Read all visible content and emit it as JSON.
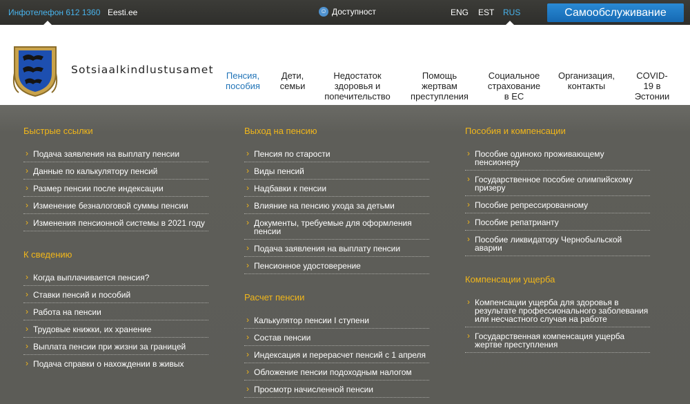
{
  "topbar": {
    "infophone": "Инфотелефон 612 1360",
    "eesti": "Eesti.ee",
    "accessibility": "Доступност",
    "accessibility_icon": "accessibility-icon",
    "lang_eng": "ENG",
    "lang_est": "EST",
    "lang_rus": "RUS",
    "self_service": "Самообслуживание",
    "accent_color": "#48b3ec",
    "button_color": "#1f73b7"
  },
  "header": {
    "site_name": "Sotsiaalkindlustusamet",
    "logo_icon": "crest-icon",
    "nav": [
      {
        "label": "Пенсия, пособия",
        "line1": "Пенсия,",
        "line2": "пособия"
      },
      {
        "label": "Дети, семьи",
        "line1": "Дети,",
        "line2": "семьи"
      },
      {
        "label": "Недостаток здоровья и попечительство",
        "line1": "Недостаток",
        "line2": "здоровья и",
        "line3": "попечительство"
      },
      {
        "label": "Помощь жертвам преступления",
        "line1": "Помощь",
        "line2": "жертвам",
        "line3": "преступления"
      },
      {
        "label": "Социальное страхование в ЕС",
        "line1": "Социальное",
        "line2": "страхование",
        "line3": "в ЕС"
      },
      {
        "label": "Организация, контакты",
        "line1": "Организация,",
        "line2": "контакты"
      },
      {
        "label": "COVID-19 в Эстонии",
        "line1": "COVID-",
        "line2": "19 в",
        "line3": "Эстонии"
      }
    ]
  },
  "menu": {
    "col1": {
      "section1_title": "Быстрые ссылки",
      "section1_items": [
        "Подача заявления на выплату пенсии",
        "Данные по калькулятору пенсий",
        "Размер пенсии после индексации",
        "Изменение безналоговой суммы пенсии",
        "Изменения пенсионной системы в 2021 году"
      ],
      "section2_title": "К сведению",
      "section2_items": [
        "Когда выплачивается пенсия?",
        "Ставки пенсий и пособий",
        "Работа на пенсии",
        "Трудовые книжки, их хранение",
        "Выплата пенсии при жизни за границей",
        "Подача справки о нахождении в живых"
      ]
    },
    "col2": {
      "section1_title": "Выход на пенсию",
      "section1_items": [
        "Пенсия по старости",
        "Виды пенсий",
        "Надбавки к пенсии",
        "Влияние на пенсию ухода за детьми",
        "Документы, требуемые для оформления пенсии",
        "Подача заявления на выплату пенсии",
        "Пенсионное удостоверение"
      ],
      "section2_title": "Расчет пенсии",
      "section2_items": [
        "Калькулятор пенсии I ступени",
        "Состав пенсии",
        "Индексация и перерасчет пенсий с 1 апреля",
        "Обложение пенсии подоходным налогом",
        "Просмотр начисленной пенсии"
      ]
    },
    "col3": {
      "section1_title": "Пособия и компенсации",
      "section1_items": [
        "Пособие одиноко проживающему пенсионеру",
        "Государственное пособие олимпийскому призеру",
        "Пособие репрессированному",
        "Пособие репатрианту",
        "Пособие ликвидатору Чернобыльской аварии"
      ],
      "section2_title": "Компенсации ущерба",
      "section2_items": [
        "Компенсации ущерба для здоровья в результате профессионального заболевания или несчастного случая на работе",
        "Государственная компенсация ущерба жертве преступления"
      ]
    },
    "title_color": "#f2b71a"
  }
}
